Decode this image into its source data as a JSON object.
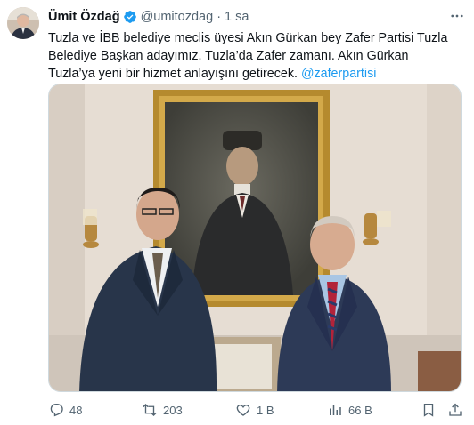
{
  "author": {
    "name": "Ümit Özdağ",
    "handle": "@umitozdag",
    "separator": "·",
    "time": "1 sa"
  },
  "tweet": {
    "text": "Tuzla ve İBB belediye meclis üyesi Akın Gürkan bey Zafer Partisi Tuzla Belediye Başkan adayımız. Tuzla’da Zafer zamanı. Akın Gürkan Tuzla’ya yeni bir hizmet anlayışını getirecek.",
    "mention": "@zaferpartisi"
  },
  "actions": {
    "replies": "48",
    "reposts": "203",
    "likes": "1 B",
    "views": "66 B"
  },
  "icons": {
    "verified": "verified-badge-icon",
    "more": "more-icon",
    "reply": "reply-icon",
    "repost": "repost-icon",
    "like": "heart-icon",
    "views": "views-icon",
    "bookmark": "bookmark-icon",
    "share": "share-icon"
  },
  "colors": {
    "accent": "#1d9bf0",
    "secondary_text": "#536471",
    "primary_text": "#0f1419"
  }
}
